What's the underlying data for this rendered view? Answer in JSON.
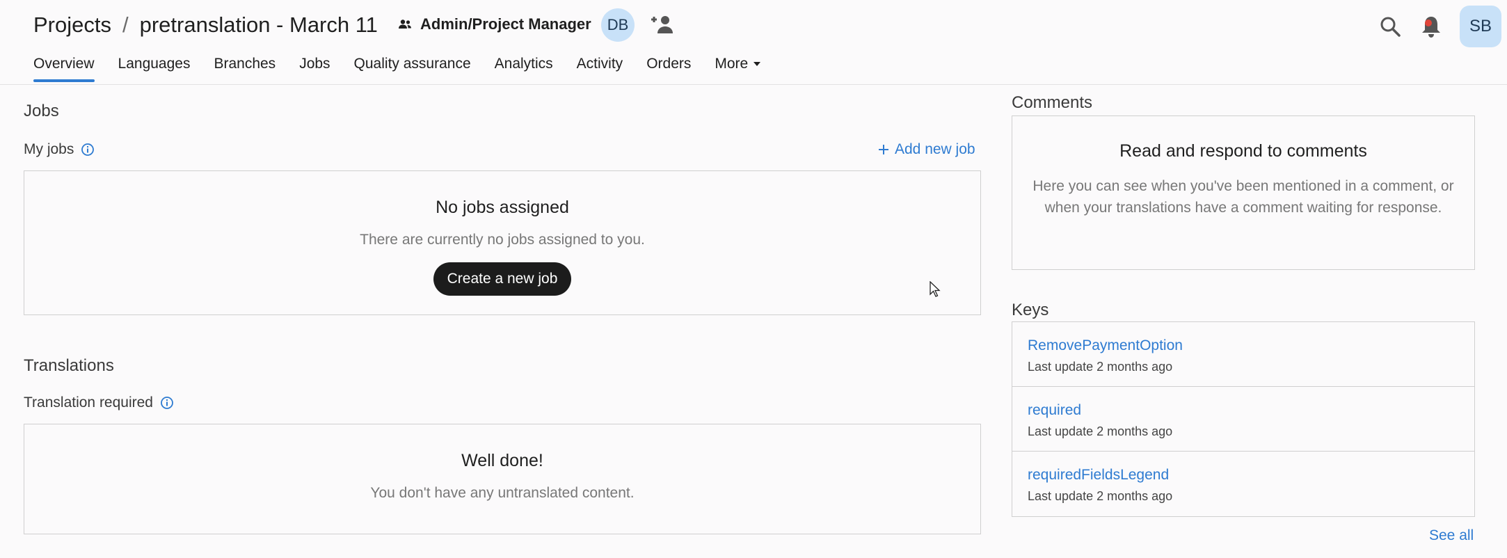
{
  "header": {
    "breadcrumb_root": "Projects",
    "breadcrumb_sep": "/",
    "project_name": "pretranslation - March 11",
    "role_label": "Admin/Project Manager",
    "member_avatar": "DB",
    "user_avatar": "SB"
  },
  "tabs": [
    {
      "label": "Overview",
      "active": true
    },
    {
      "label": "Languages"
    },
    {
      "label": "Branches"
    },
    {
      "label": "Jobs"
    },
    {
      "label": "Quality assurance"
    },
    {
      "label": "Analytics"
    },
    {
      "label": "Activity"
    },
    {
      "label": "Orders"
    },
    {
      "label": "More"
    }
  ],
  "jobs": {
    "section_title": "Jobs",
    "subtitle": "My jobs",
    "add_link": "Add new job",
    "empty_title": "No jobs assigned",
    "empty_text": "There are currently no jobs assigned to you.",
    "create_button": "Create a new job"
  },
  "translations": {
    "section_title": "Translations",
    "subtitle": "Translation required",
    "done_title": "Well done!",
    "done_text": "You don't have any untranslated content."
  },
  "comments": {
    "section_title": "Comments",
    "card_title": "Read and respond to comments",
    "card_text": "Here you can see when you've been mentioned in a comment, or when your translations have a comment waiting for response."
  },
  "keys": {
    "section_title": "Keys",
    "items": [
      {
        "name": "RemovePaymentOption",
        "meta": "Last update 2 months ago"
      },
      {
        "name": "required",
        "meta": "Last update 2 months ago"
      },
      {
        "name": "requiredFieldsLegend",
        "meta": "Last update 2 months ago"
      }
    ],
    "see_all": "See all"
  },
  "icons": {
    "role": "people-icon",
    "add_user": "add-person-icon",
    "search": "search-icon",
    "notifications": "bell-icon",
    "info": "info-icon",
    "more_caret": "caret-down-icon",
    "add": "plus-icon"
  },
  "colors": {
    "accent": "#2e7bd1",
    "avatar_bg": "#c8e1f8",
    "button_dark": "#1c1c1c",
    "notification_dot": "#e0453a"
  }
}
